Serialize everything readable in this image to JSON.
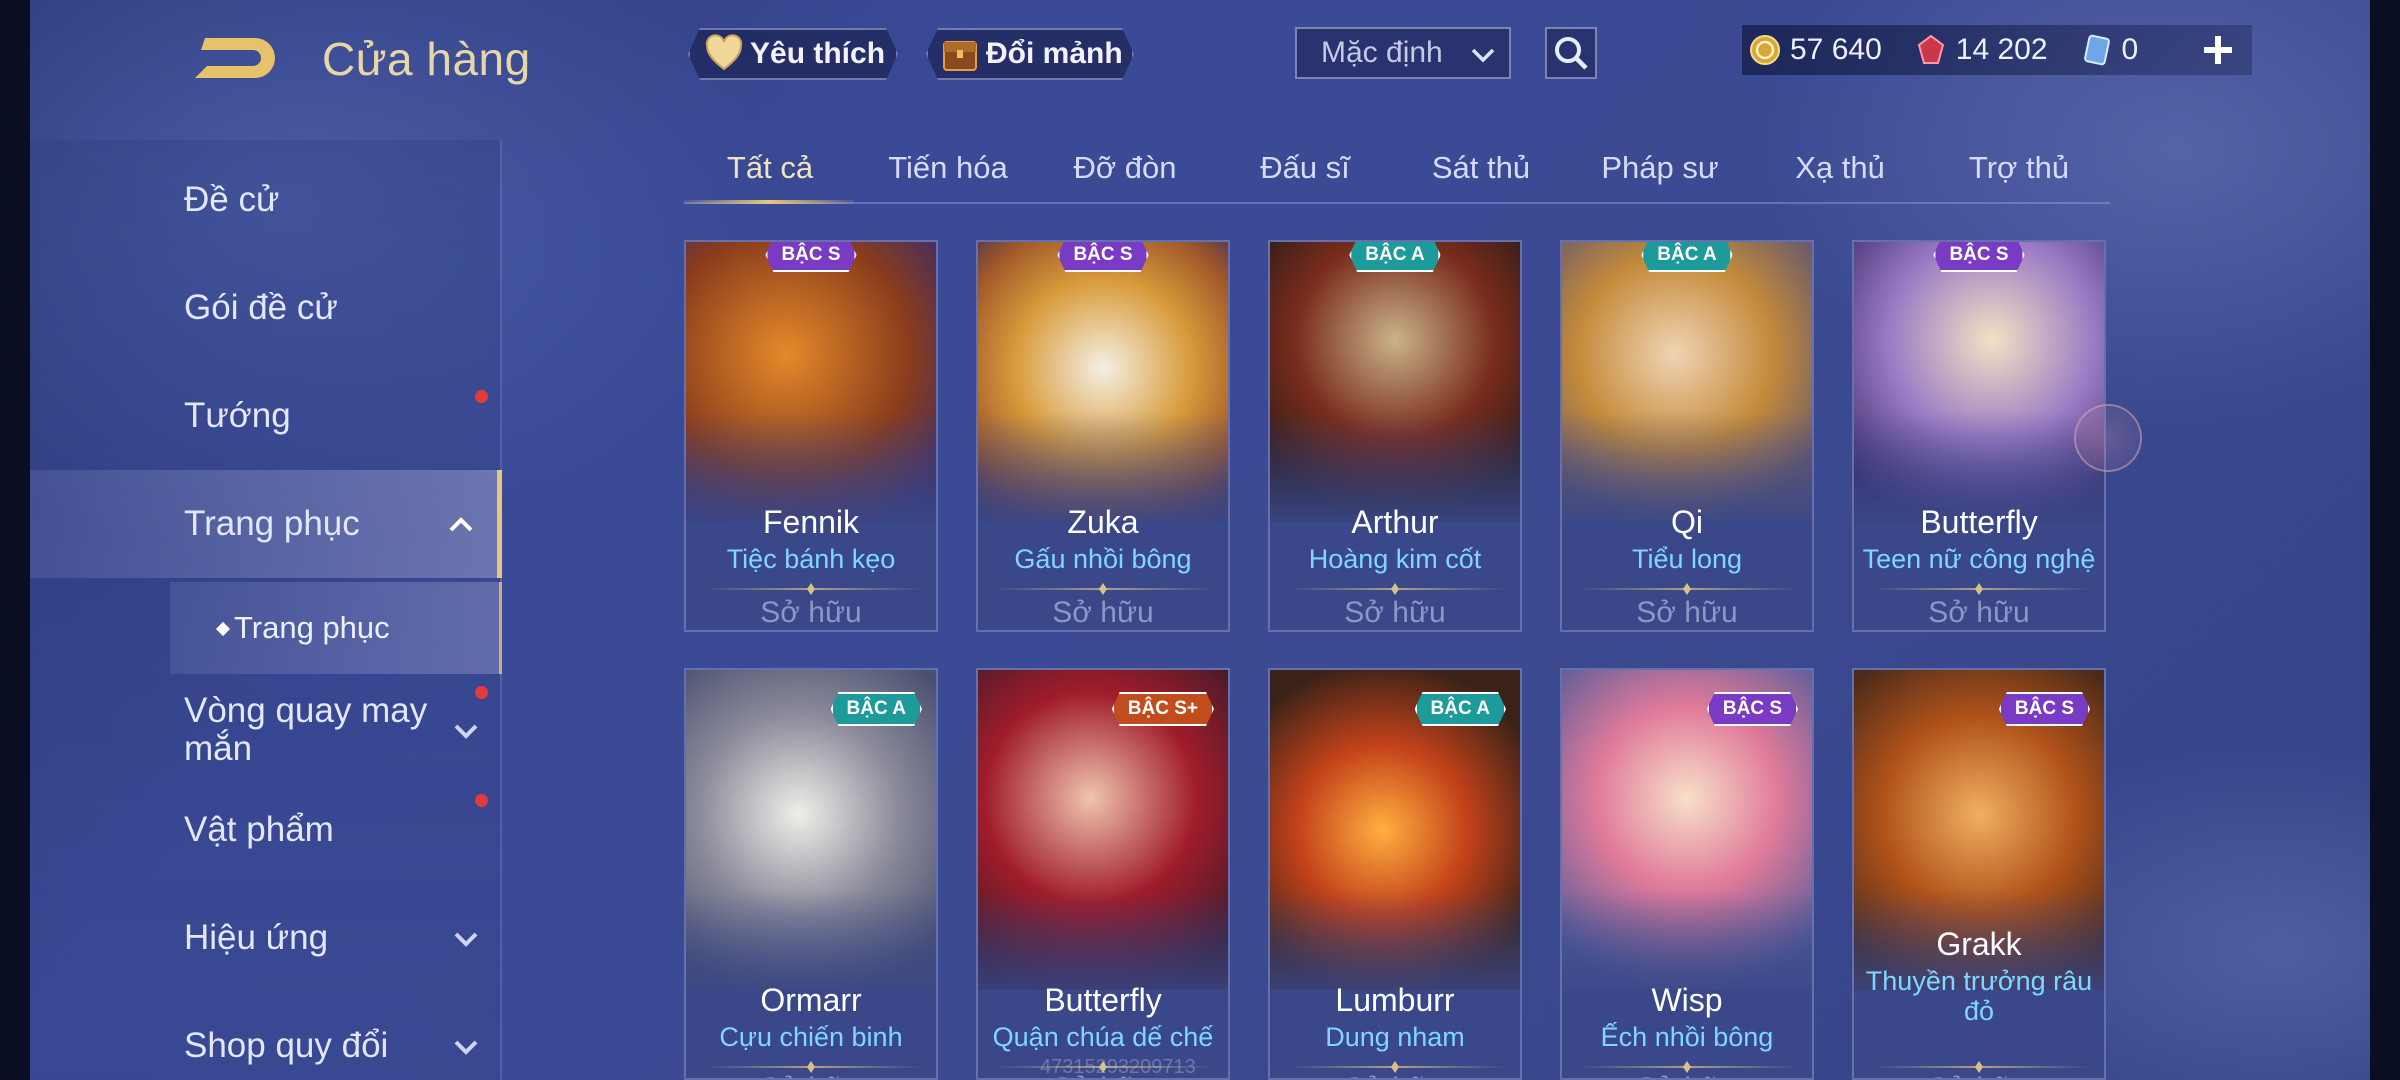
{
  "header": {
    "title": "Cửa hàng",
    "favorite_label": "Yêu thích",
    "exchange_label": "Đổi mảnh",
    "sort_value": "Mặc định"
  },
  "currency": {
    "gold": "57 640",
    "gems": "14 202",
    "tickets": "0"
  },
  "sidebar": {
    "items": [
      {
        "label": "Đề cử"
      },
      {
        "label": "Gói đề cử"
      },
      {
        "label": "Tướng"
      },
      {
        "label": "Trang phục"
      },
      {
        "label": "Vòng quay may mắn"
      },
      {
        "label": "Vật phẩm"
      },
      {
        "label": "Hiệu ứng"
      },
      {
        "label": "Shop quy đổi"
      }
    ],
    "sub_active": "Trang phục"
  },
  "tabs": [
    "Tất cả",
    "Tiến hóa",
    "Đỡ đòn",
    "Đấu sĩ",
    "Sát thủ",
    "Pháp sư",
    "Xạ thủ",
    "Trợ thủ"
  ],
  "cards": [
    {
      "rank": "BẬC S",
      "hero": "Fennik",
      "skin": "Tiệc bánh kẹo",
      "status": "Sở hữu"
    },
    {
      "rank": "BẬC S",
      "hero": "Zuka",
      "skin": "Gấu nhồi bông",
      "status": "Sở hữu"
    },
    {
      "rank": "BẬC A",
      "hero": "Arthur",
      "skin": "Hoàng kim cốt",
      "status": "Sở hữu"
    },
    {
      "rank": "BẬC A",
      "hero": "Qi",
      "skin": "Tiểu long",
      "status": "Sở hữu"
    },
    {
      "rank": "BẬC S",
      "hero": "Butterfly",
      "skin": "Teen nữ công nghệ",
      "status": "Sở hữu"
    },
    {
      "rank": "BẬC A",
      "hero": "Ormarr",
      "skin": "Cựu chiến binh",
      "status": "Sở hữu"
    },
    {
      "rank": "BẬC S+",
      "hero": "Butterfly",
      "skin": "Quận chúa dế chế",
      "status": "Sở hữu"
    },
    {
      "rank": "BẬC A",
      "hero": "Lumburr",
      "skin": "Dung nham",
      "status": "Sở hữu"
    },
    {
      "rank": "BẬC S",
      "hero": "Wisp",
      "skin": "Ếch nhồi bông",
      "status": "Sở hữu"
    },
    {
      "rank": "BẬC S",
      "hero": "Grakk",
      "skin": "Thuyền trưởng râu đỏ",
      "status": "Sở hữu"
    }
  ],
  "watermark": "47315293209713",
  "colors": {
    "accent_gold": "#e8c87a",
    "skin_name": "#7fd7ff",
    "notify_dot": "#e33a3a"
  }
}
